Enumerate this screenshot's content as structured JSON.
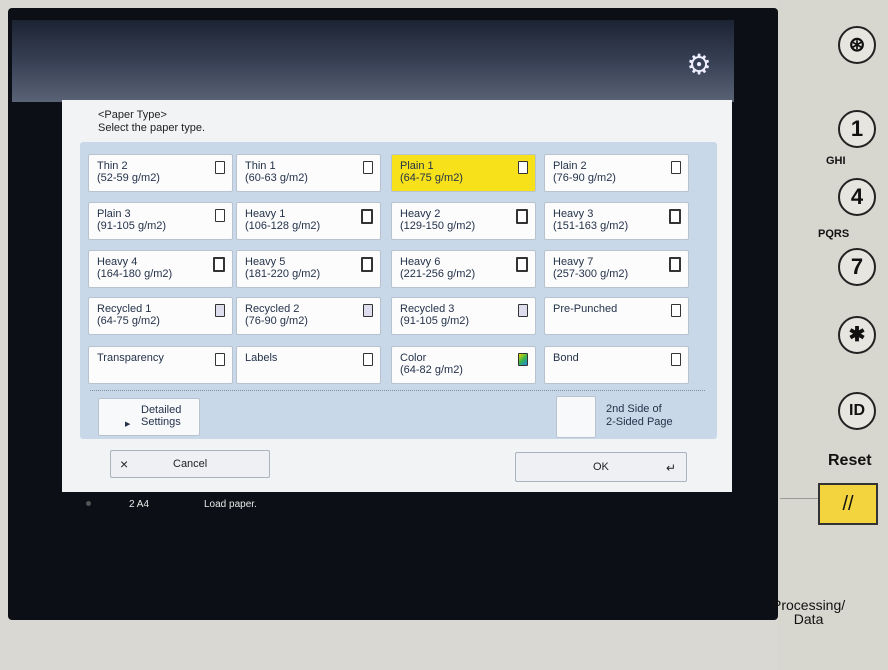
{
  "header": {
    "title": "<Paper Type>",
    "subtitle": "Select the paper type."
  },
  "paper_types": [
    {
      "name": "Thin 2",
      "weight": "(52-59 g/m2)",
      "icon": "paper-thin-icon",
      "selected": false
    },
    {
      "name": "Thin 1",
      "weight": "(60-63 g/m2)",
      "icon": "paper-thin-icon",
      "selected": false
    },
    {
      "name": "Plain 1",
      "weight": "(64-75 g/m2)",
      "icon": "paper-icon",
      "selected": true
    },
    {
      "name": "Plain 2",
      "weight": "(76-90 g/m2)",
      "icon": "paper-icon",
      "selected": false
    },
    {
      "name": "Plain 3",
      "weight": "(91-105 g/m2)",
      "icon": "paper-icon",
      "selected": false
    },
    {
      "name": "Heavy 1",
      "weight": "(106-128 g/m2)",
      "icon": "paper-heavy-icon",
      "selected": false
    },
    {
      "name": "Heavy 2",
      "weight": "(129-150 g/m2)",
      "icon": "paper-heavy-icon",
      "selected": false
    },
    {
      "name": "Heavy 3",
      "weight": "(151-163 g/m2)",
      "icon": "paper-heavy-icon",
      "selected": false
    },
    {
      "name": "Heavy 4",
      "weight": "(164-180 g/m2)",
      "icon": "paper-heavy-icon",
      "selected": false
    },
    {
      "name": "Heavy 5",
      "weight": "(181-220 g/m2)",
      "icon": "paper-heavy-icon",
      "selected": false
    },
    {
      "name": "Heavy 6",
      "weight": "(221-256 g/m2)",
      "icon": "paper-heavy-icon",
      "selected": false
    },
    {
      "name": "Heavy 7",
      "weight": "(257-300 g/m2)",
      "icon": "paper-heavy-icon",
      "selected": false
    },
    {
      "name": "Recycled 1",
      "weight": "(64-75 g/m2)",
      "icon": "recycled-paper-icon",
      "selected": false
    },
    {
      "name": "Recycled 2",
      "weight": "(76-90 g/m2)",
      "icon": "recycled-paper-icon",
      "selected": false
    },
    {
      "name": "Recycled 3",
      "weight": "(91-105 g/m2)",
      "icon": "recycled-paper-icon",
      "selected": false
    },
    {
      "name": "Pre-Punched",
      "weight": "",
      "icon": "punched-paper-icon",
      "selected": false
    },
    {
      "name": "Transparency",
      "weight": "",
      "icon": "transparency-icon",
      "selected": false
    },
    {
      "name": "Labels",
      "weight": "",
      "icon": "labels-icon",
      "selected": false
    },
    {
      "name": "Color",
      "weight": "(64-82 g/m2)",
      "icon": "color-paper-icon",
      "selected": false
    },
    {
      "name": "Bond",
      "weight": "",
      "icon": "paper-icon",
      "selected": false
    }
  ],
  "detailed_settings": {
    "line1": "Detailed",
    "line2": "Settings"
  },
  "second_side": {
    "line1": "2nd Side of",
    "line2": "2-Sided Page"
  },
  "cancel": {
    "icon": "×",
    "label": "Cancel"
  },
  "ok": {
    "label": "OK",
    "icon": "↵"
  },
  "status": {
    "counter": "2  A4",
    "message": "Load paper."
  },
  "keypad": {
    "gear": "⚙",
    "keys": [
      "⊛",
      "1",
      "4",
      "7",
      "✱",
      "ID"
    ],
    "letter_labels": [
      "GHI",
      "PQRS"
    ],
    "reset_label": "Reset",
    "reset_icon": "//",
    "processing_line1": "Processing/",
    "processing_line2": "Data"
  },
  "colors": {
    "selected": "#f7e11a",
    "panel": "#c9d8e8"
  }
}
